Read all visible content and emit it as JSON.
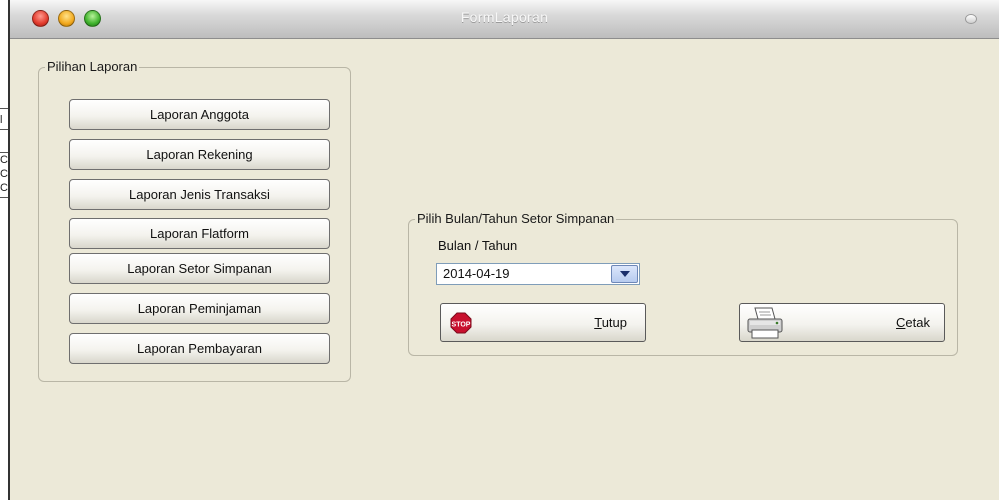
{
  "window": {
    "title": "FormLaporan"
  },
  "left_partial": {
    "rows": [
      "l",
      "C",
      "C",
      "C"
    ]
  },
  "report_group": {
    "label": "Pilihan Laporan",
    "buttons": [
      "Laporan Anggota",
      "Laporan Rekening",
      "Laporan Jenis Transaksi",
      "Laporan Flatform",
      "Laporan Setor Simpanan",
      "Laporan Peminjaman",
      "Laporan Pembayaran"
    ]
  },
  "deposit_group": {
    "label": "Pilih Bulan/Tahun Setor Simpanan",
    "field_label": "Bulan / Tahun",
    "date_value": "2014-04-19",
    "close_button": {
      "label_first": "T",
      "label_rest": "utup",
      "icon_text": "STOP"
    },
    "print_button": {
      "label_first": "C",
      "label_rest": "etak"
    }
  }
}
